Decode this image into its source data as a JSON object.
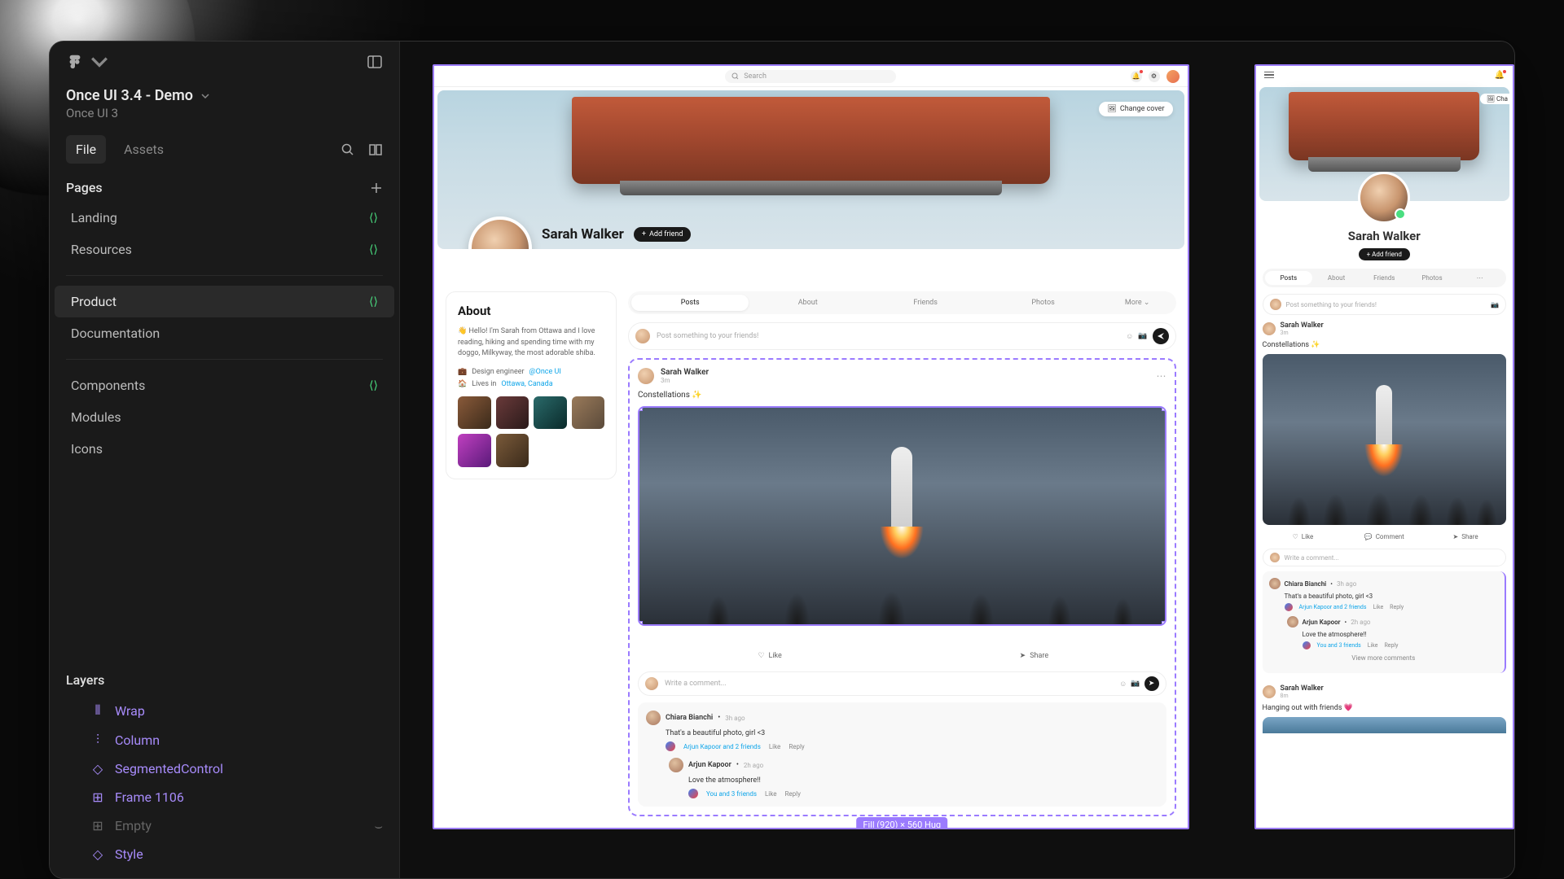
{
  "window": {
    "title": "Once UI 3.4 - Demo",
    "subtitle": "Once UI 3"
  },
  "sidebar_tabs": {
    "file": "File",
    "assets": "Assets"
  },
  "pages_header": "Pages",
  "pages": [
    {
      "label": "Landing"
    },
    {
      "label": "Resources"
    },
    {
      "label": "Product",
      "selected": true
    },
    {
      "label": "Documentation"
    },
    {
      "label": "Components"
    },
    {
      "label": "Modules"
    },
    {
      "label": "Icons"
    }
  ],
  "layers_header": "Layers",
  "layers": [
    {
      "label": "Wrap",
      "color": "purple",
      "icon": "wrap"
    },
    {
      "label": "Column",
      "color": "purple",
      "icon": "column"
    },
    {
      "label": "SegmentedControl",
      "color": "purple",
      "icon": "diamond"
    },
    {
      "label": "Frame 1106",
      "color": "purple",
      "icon": "frame"
    },
    {
      "label": "Empty",
      "color": "dim",
      "icon": "frame",
      "eye": true
    },
    {
      "label": "Style",
      "color": "purple",
      "icon": "diamond"
    }
  ],
  "selection_label": "Fill (920) × 560 Hug",
  "desktop": {
    "search_placeholder": "Search",
    "cover_btn": "Change cover",
    "profile_name": "Sarah Walker",
    "add_friend": "Add friend",
    "about": {
      "title": "About",
      "bio": "👋 Hello! I'm Sarah from Ottawa and I love reading, hiking and spending time with my doggo, Milkyway, the most adorable shiba.",
      "job_prefix": "Design engineer ",
      "job_link": "@Once UI",
      "lives_prefix": "Lives in ",
      "lives_link": "Ottawa, Canada"
    },
    "tabs": [
      "Posts",
      "About",
      "Friends",
      "Photos",
      "More"
    ],
    "compose_placeholder": "Post something to your friends!",
    "post": {
      "author": "Sarah Walker",
      "time": "3m",
      "text": "Constellations ✨",
      "like": "Like",
      "share": "Share"
    },
    "comment_placeholder": "Write a comment...",
    "comments": [
      {
        "author": "Chiara Bianchi",
        "time": "3h ago",
        "text": "That's a beautiful photo, girl <3",
        "reactions": "Arjun Kapoor and 2 friends",
        "like": "Like",
        "reply": "Reply"
      },
      {
        "author": "Arjun Kapoor",
        "time": "2h ago",
        "text": "Love the atmosphere!!",
        "reactions": "You and 3 friends",
        "like": "Like",
        "reply": "Reply"
      }
    ]
  },
  "mobile": {
    "cover_btn": "Cha",
    "profile_name": "Sarah Walker",
    "add_friend": "Add friend",
    "tabs": [
      "Posts",
      "About",
      "Friends",
      "Photos"
    ],
    "compose_placeholder": "Post something to your friends!",
    "post": {
      "author": "Sarah Walker",
      "time": "3m",
      "text": "Constellations ✨",
      "like": "Like",
      "comment": "Comment",
      "share": "Share"
    },
    "comment_placeholder": "Write a comment...",
    "comments": [
      {
        "author": "Chiara Bianchi",
        "time": "3h ago",
        "text": "That's a beautiful photo, girl <3",
        "reactions": "Arjun Kapoor and 2 friends",
        "like": "Like",
        "reply": "Reply"
      },
      {
        "author": "Arjun Kapoor",
        "time": "2h ago",
        "text": "Love the atmosphere!!",
        "reactions": "You and 3 friends",
        "like": "Like",
        "reply": "Reply"
      }
    ],
    "view_more": "View more comments",
    "post2": {
      "author": "Sarah Walker",
      "time": "8m",
      "text": "Hanging out with friends 💗"
    }
  }
}
